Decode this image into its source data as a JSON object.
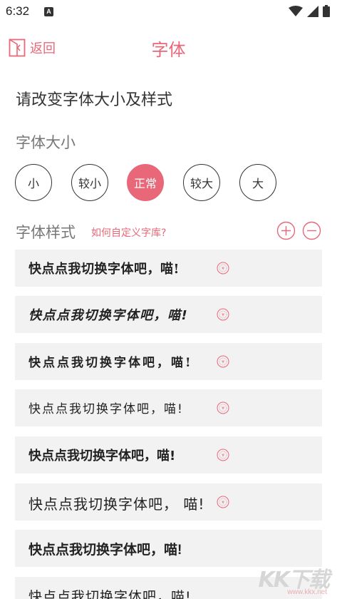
{
  "status_bar": {
    "time": "6:32",
    "notification_badge": "A"
  },
  "header": {
    "back_label": "返回",
    "title": "字体"
  },
  "prompt": "请改变字体大小及样式",
  "font_size": {
    "heading": "字体大小",
    "options": [
      "小",
      "较小",
      "正常",
      "较大",
      "大"
    ],
    "selected": "正常"
  },
  "font_style": {
    "heading": "字体样式",
    "custom_link": "如何自定义字库?",
    "items": [
      {
        "sample": "快点点我切换字体吧，喵!"
      },
      {
        "sample": "快点点我切换字体吧，喵!"
      },
      {
        "sample": "快点点我切换字体吧，喵!"
      },
      {
        "sample": "快点点我切换字体吧，喵!"
      },
      {
        "sample": "快点点我切换字体吧，喵!"
      },
      {
        "sample": "快点点我切换字体吧，  喵!"
      },
      {
        "sample": "快点点我切换字体吧，喵!"
      },
      {
        "sample": "快点点我切换字体吧，喵!"
      }
    ]
  },
  "watermark": {
    "text": "KK下载",
    "url": "www.kkx.net"
  },
  "colors": {
    "accent": "#e8687a",
    "item_background": "#f2f2f2"
  }
}
